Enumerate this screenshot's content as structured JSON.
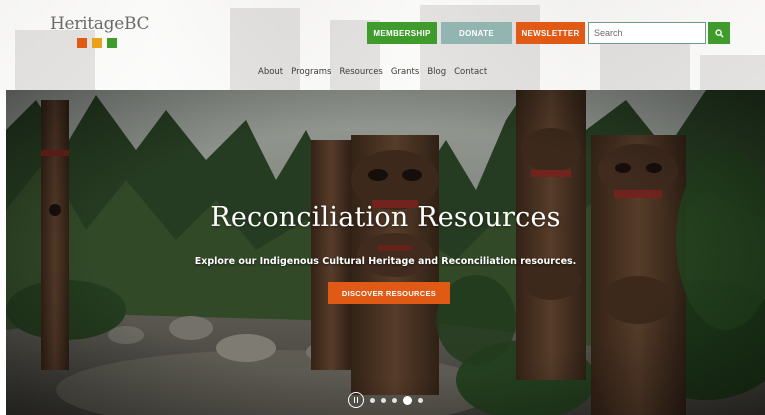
{
  "header": {
    "logo": {
      "text": "HeritageBC",
      "squares": [
        "#e05a16",
        "#e6a21a",
        "#3e9b2c"
      ]
    },
    "buttons": {
      "membership": "MEMBERSHIP",
      "donate": "DONATE",
      "newsletter": "NEWSLETTER"
    },
    "search": {
      "placeholder": "Search",
      "icon": "search-icon"
    },
    "nav": [
      "About",
      "Programs",
      "Resources",
      "Grants",
      "Blog",
      "Contact"
    ]
  },
  "hero": {
    "title": "Reconciliation Resources",
    "subtitle": "Explore our Indigenous Cultural Heritage and Reconciliation resources.",
    "cta": "DISCOVER RESOURCES",
    "slides": {
      "count": 5,
      "active_index": 3
    }
  },
  "colors": {
    "membership": "#3e9b2c",
    "donate": "#93b5b1",
    "newsletter": "#e05a16",
    "search_button": "#3e9b2c",
    "cta": "#e05a16"
  }
}
